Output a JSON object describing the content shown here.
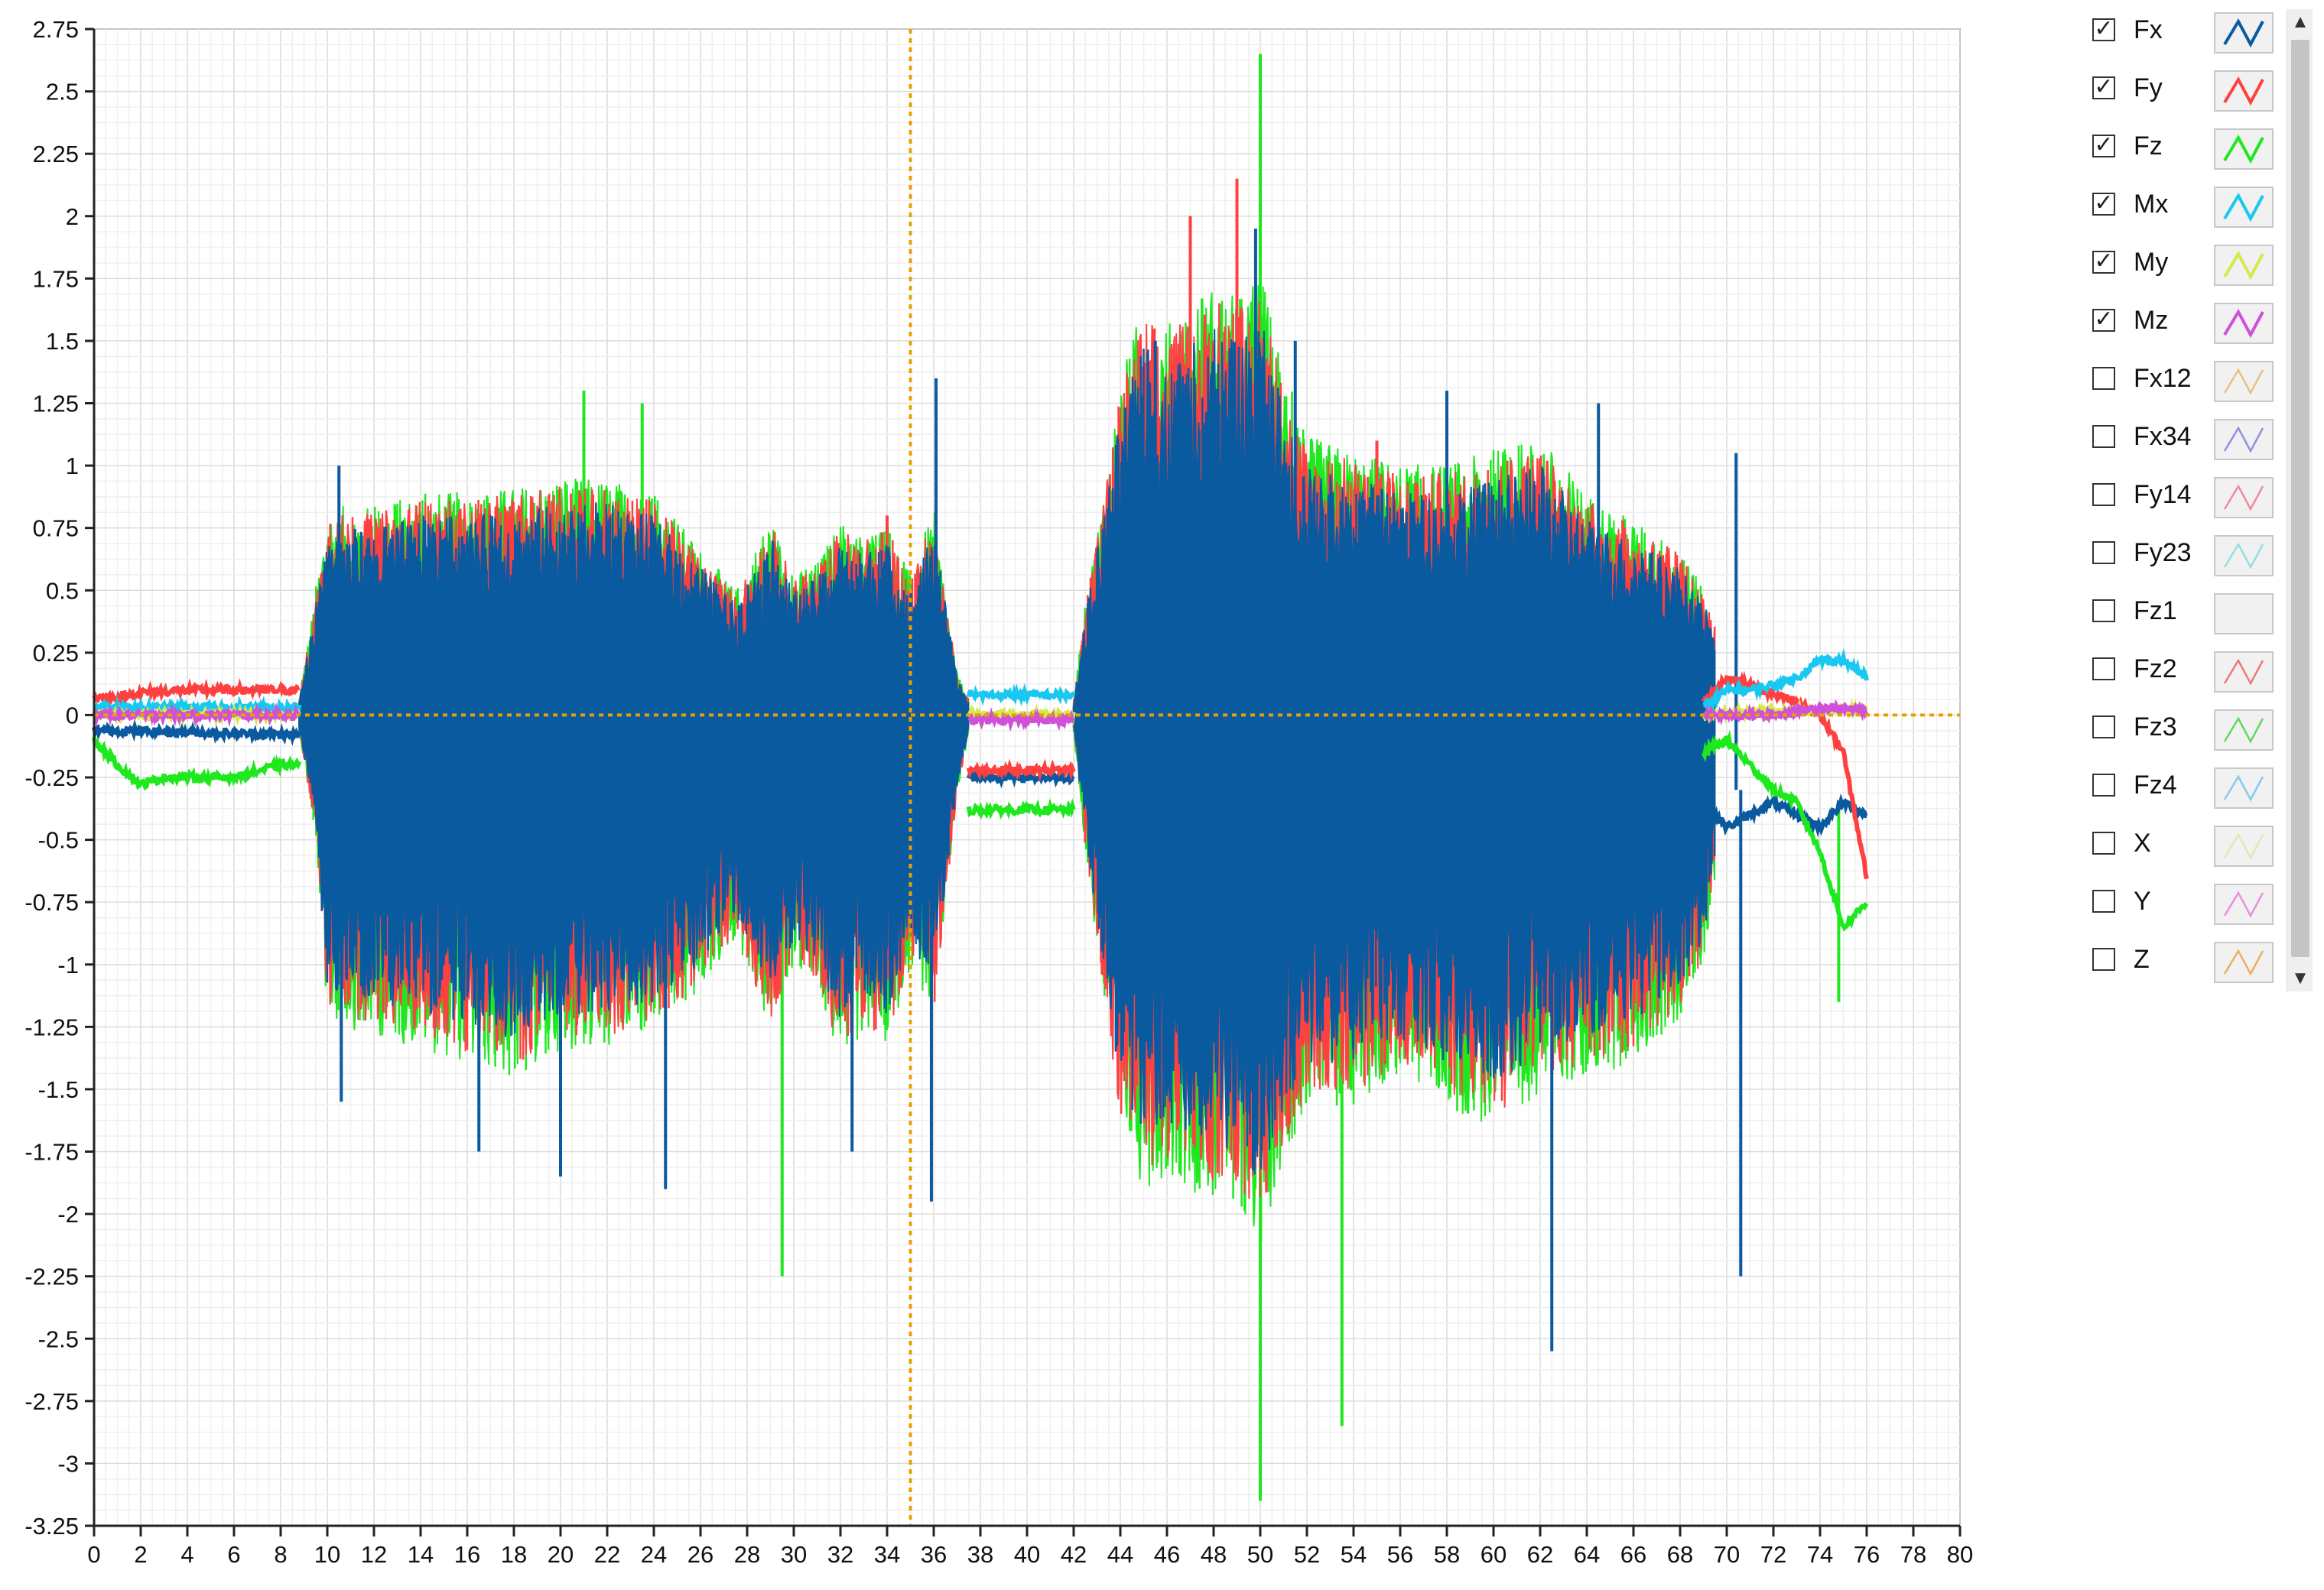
{
  "chart_data": {
    "type": "line",
    "xlabel": "",
    "ylabel": "",
    "xlim": [
      0,
      80
    ],
    "ylim": [
      -3.25,
      2.75
    ],
    "x_ticks": [
      0,
      2,
      4,
      6,
      8,
      10,
      12,
      14,
      16,
      18,
      20,
      22,
      24,
      26,
      28,
      30,
      32,
      34,
      36,
      38,
      40,
      42,
      44,
      46,
      48,
      50,
      52,
      54,
      56,
      58,
      60,
      62,
      64,
      66,
      68,
      70,
      72,
      74,
      76,
      78,
      80
    ],
    "y_ticks": [
      2.75,
      2.5,
      2.25,
      2,
      1.75,
      1.5,
      1.25,
      1,
      0.75,
      0.5,
      0.25,
      0,
      -0.25,
      -0.5,
      -0.75,
      -1,
      -1.25,
      -1.5,
      -1.75,
      -2,
      -2.25,
      -2.5,
      -2.75,
      -3,
      -3.25
    ],
    "grid": true,
    "legend_position": "right",
    "cursor": {
      "x": 35,
      "y": 0,
      "color": "#e8a000"
    },
    "envelope": {
      "x": [
        0,
        8.8,
        9.5,
        10,
        12,
        14,
        16,
        18,
        20,
        22,
        24,
        26,
        27.5,
        29,
        30,
        31,
        32,
        33,
        34,
        35,
        36,
        37,
        37.5,
        42,
        42.5,
        44,
        45,
        46,
        47,
        48,
        49,
        50,
        51,
        52,
        54,
        56,
        58,
        60,
        62,
        64,
        66,
        68,
        69,
        70,
        71,
        72,
        73,
        74,
        75,
        76
      ],
      "max": [
        0.05,
        0.06,
        0.45,
        0.75,
        0.75,
        0.8,
        0.8,
        0.82,
        0.85,
        0.85,
        0.8,
        0.6,
        0.45,
        0.72,
        0.5,
        0.55,
        0.7,
        0.65,
        0.7,
        0.5,
        0.75,
        0.15,
        0.06,
        0.06,
        0.4,
        1.2,
        1.5,
        1.4,
        1.5,
        1.55,
        1.5,
        1.6,
        1.25,
        1.0,
        0.95,
        0.9,
        0.9,
        0.95,
        1.0,
        0.8,
        0.7,
        0.6,
        0.45,
        0.2,
        0.1,
        0.1,
        0.05,
        0.05,
        0.05,
        0.05
      ],
      "min": [
        -0.05,
        -0.06,
        -0.45,
        -1.1,
        -1.15,
        -1.2,
        -1.25,
        -1.3,
        -1.2,
        -1.2,
        -1.15,
        -1.0,
        -0.8,
        -1.15,
        -0.9,
        -1.0,
        -1.25,
        -1.15,
        -1.2,
        -0.9,
        -1.1,
        -0.3,
        -0.06,
        -0.06,
        -0.5,
        -1.5,
        -1.7,
        -1.65,
        -1.7,
        -1.75,
        -1.75,
        -1.9,
        -1.6,
        -1.4,
        -1.4,
        -1.3,
        -1.4,
        -1.5,
        -1.35,
        -1.3,
        -1.25,
        -1.1,
        -0.9,
        -0.3,
        -0.15,
        -0.15,
        -0.1,
        -0.05,
        -0.05,
        -0.05
      ]
    },
    "series": [
      {
        "name": "Fx",
        "color": "#0a5aa0",
        "visible": true,
        "segments": [
          {
            "x": [
              0,
              8.8
            ],
            "y": [
              -0.06,
              -0.08
            ]
          },
          {
            "x": [
              37.5,
              42
            ],
            "y": [
              -0.25,
              -0.25
            ]
          },
          {
            "x": [
              69,
              70,
              71,
              72,
              73,
              74,
              75,
              76
            ],
            "y": [
              -0.35,
              -0.45,
              -0.4,
              -0.35,
              -0.4,
              -0.45,
              -0.35,
              -0.4
            ]
          }
        ],
        "spikes": [
          {
            "x": 10.5,
            "y": 1.0
          },
          {
            "x": 10.6,
            "y": -1.55
          },
          {
            "x": 15,
            "y": 0.7
          },
          {
            "x": 16.5,
            "y": -1.75
          },
          {
            "x": 20,
            "y": -1.85
          },
          {
            "x": 24.5,
            "y": -1.9
          },
          {
            "x": 32.5,
            "y": -1.75
          },
          {
            "x": 35.9,
            "y": -1.95
          },
          {
            "x": 36.1,
            "y": 1.35
          },
          {
            "x": 45.5,
            "y": 1.5
          },
          {
            "x": 49.8,
            "y": 1.95
          },
          {
            "x": 51.5,
            "y": 1.5
          },
          {
            "x": 58,
            "y": 1.3
          },
          {
            "x": 62.5,
            "y": -2.55
          },
          {
            "x": 64.5,
            "y": 1.25
          },
          {
            "x": 70.6,
            "y": -2.25
          },
          {
            "x": 70.4,
            "y": 1.05
          }
        ],
        "mid": -0.3
      },
      {
        "name": "Fy",
        "color": "#ff4040",
        "visible": true,
        "segments": [
          {
            "x": [
              0,
              1,
              2,
              4,
              6,
              8.8
            ],
            "y": [
              0.07,
              0.07,
              0.09,
              0.1,
              0.1,
              0.1
            ]
          },
          {
            "x": [
              37.5,
              42
            ],
            "y": [
              -0.22,
              -0.22
            ]
          },
          {
            "x": [
              69,
              70,
              71,
              72,
              73,
              74,
              75,
              76
            ],
            "y": [
              0.05,
              0.15,
              0.12,
              0.08,
              0.05,
              0.0,
              -0.15,
              -0.65
            ]
          }
        ],
        "spikes": [
          {
            "x": 47,
            "y": 2.0
          },
          {
            "x": 49,
            "y": 2.15
          },
          {
            "x": 34,
            "y": 0.8
          },
          {
            "x": 55,
            "y": 1.1
          }
        ],
        "mid": -0.2
      },
      {
        "name": "Fz",
        "color": "#1ee81e",
        "visible": true,
        "segments": [
          {
            "x": [
              0,
              1,
              2,
              3,
              4,
              6,
              8,
              8.8
            ],
            "y": [
              -0.1,
              -0.2,
              -0.28,
              -0.25,
              -0.25,
              -0.25,
              -0.2,
              -0.2
            ]
          },
          {
            "x": [
              37.5,
              42
            ],
            "y": [
              -0.38,
              -0.38
            ]
          },
          {
            "x": [
              69,
              70,
              71,
              72,
              73,
              74,
              75,
              76
            ],
            "y": [
              -0.15,
              -0.1,
              -0.2,
              -0.3,
              -0.35,
              -0.55,
              -0.85,
              -0.75
            ]
          }
        ],
        "spikes": [
          {
            "x": 50,
            "y": 2.65
          },
          {
            "x": 50,
            "y": -3.15
          },
          {
            "x": 29.5,
            "y": -2.25
          },
          {
            "x": 21,
            "y": 1.3
          },
          {
            "x": 23.5,
            "y": 1.25
          },
          {
            "x": 53.5,
            "y": -2.85
          },
          {
            "x": 74.8,
            "y": -1.15
          }
        ],
        "mid": -0.35
      },
      {
        "name": "Mx",
        "color": "#18c8f0",
        "visible": true,
        "segments": [
          {
            "x": [
              0,
              8.8
            ],
            "y": [
              0.03,
              0.03
            ]
          },
          {
            "x": [
              37.5,
              42
            ],
            "y": [
              0.08,
              0.08
            ]
          },
          {
            "x": [
              69,
              70,
              71,
              72,
              73,
              74,
              75,
              76
            ],
            "y": [
              0.03,
              0.1,
              0.1,
              0.12,
              0.15,
              0.22,
              0.22,
              0.15
            ]
          }
        ],
        "spikes": [],
        "mid": 0.03
      },
      {
        "name": "My",
        "color": "#d6e84a",
        "visible": true,
        "segments": [
          {
            "x": [
              0,
              8.8
            ],
            "y": [
              0.0,
              0.0
            ]
          },
          {
            "x": [
              37.5,
              42
            ],
            "y": [
              0.0,
              0.0
            ]
          },
          {
            "x": [
              69,
              72,
              76
            ],
            "y": [
              0.0,
              0.02,
              0.02
            ]
          }
        ],
        "spikes": [],
        "mid": 0.0
      },
      {
        "name": "Mz",
        "color": "#d050d8",
        "visible": true,
        "segments": [
          {
            "x": [
              0,
              8.8
            ],
            "y": [
              0.0,
              0.0
            ]
          },
          {
            "x": [
              37.5,
              42
            ],
            "y": [
              -0.02,
              -0.02
            ]
          },
          {
            "x": [
              69,
              72,
              74,
              76
            ],
            "y": [
              0.0,
              0.0,
              0.03,
              0.02
            ]
          }
        ],
        "spikes": [],
        "mid": 0.0
      }
    ]
  },
  "legend": {
    "items": [
      {
        "label": "Fx",
        "checked": true,
        "color": "#0a5aa0"
      },
      {
        "label": "Fy",
        "checked": true,
        "color": "#ff4040"
      },
      {
        "label": "Fz",
        "checked": true,
        "color": "#1ee81e"
      },
      {
        "label": "Mx",
        "checked": true,
        "color": "#18c8f0"
      },
      {
        "label": "My",
        "checked": true,
        "color": "#d6e84a"
      },
      {
        "label": "Mz",
        "checked": true,
        "color": "#d050d8"
      },
      {
        "label": "Fx12",
        "checked": false,
        "color": "#e8c080"
      },
      {
        "label": "Fx34",
        "checked": false,
        "color": "#9090e0"
      },
      {
        "label": "Fy14",
        "checked": false,
        "color": "#f08aa0"
      },
      {
        "label": "Fy23",
        "checked": false,
        "color": "#90e0e0"
      },
      {
        "label": "Fz1",
        "checked": false,
        "color": ""
      },
      {
        "label": "Fz2",
        "checked": false,
        "color": "#f07878"
      },
      {
        "label": "Fz3",
        "checked": false,
        "color": "#60d860"
      },
      {
        "label": "Fz4",
        "checked": false,
        "color": "#88c8f0"
      },
      {
        "label": "X",
        "checked": false,
        "color": "#e0e8b0"
      },
      {
        "label": "Y",
        "checked": false,
        "color": "#e890e0"
      },
      {
        "label": "Z",
        "checked": false,
        "color": "#e8b060"
      }
    ]
  }
}
